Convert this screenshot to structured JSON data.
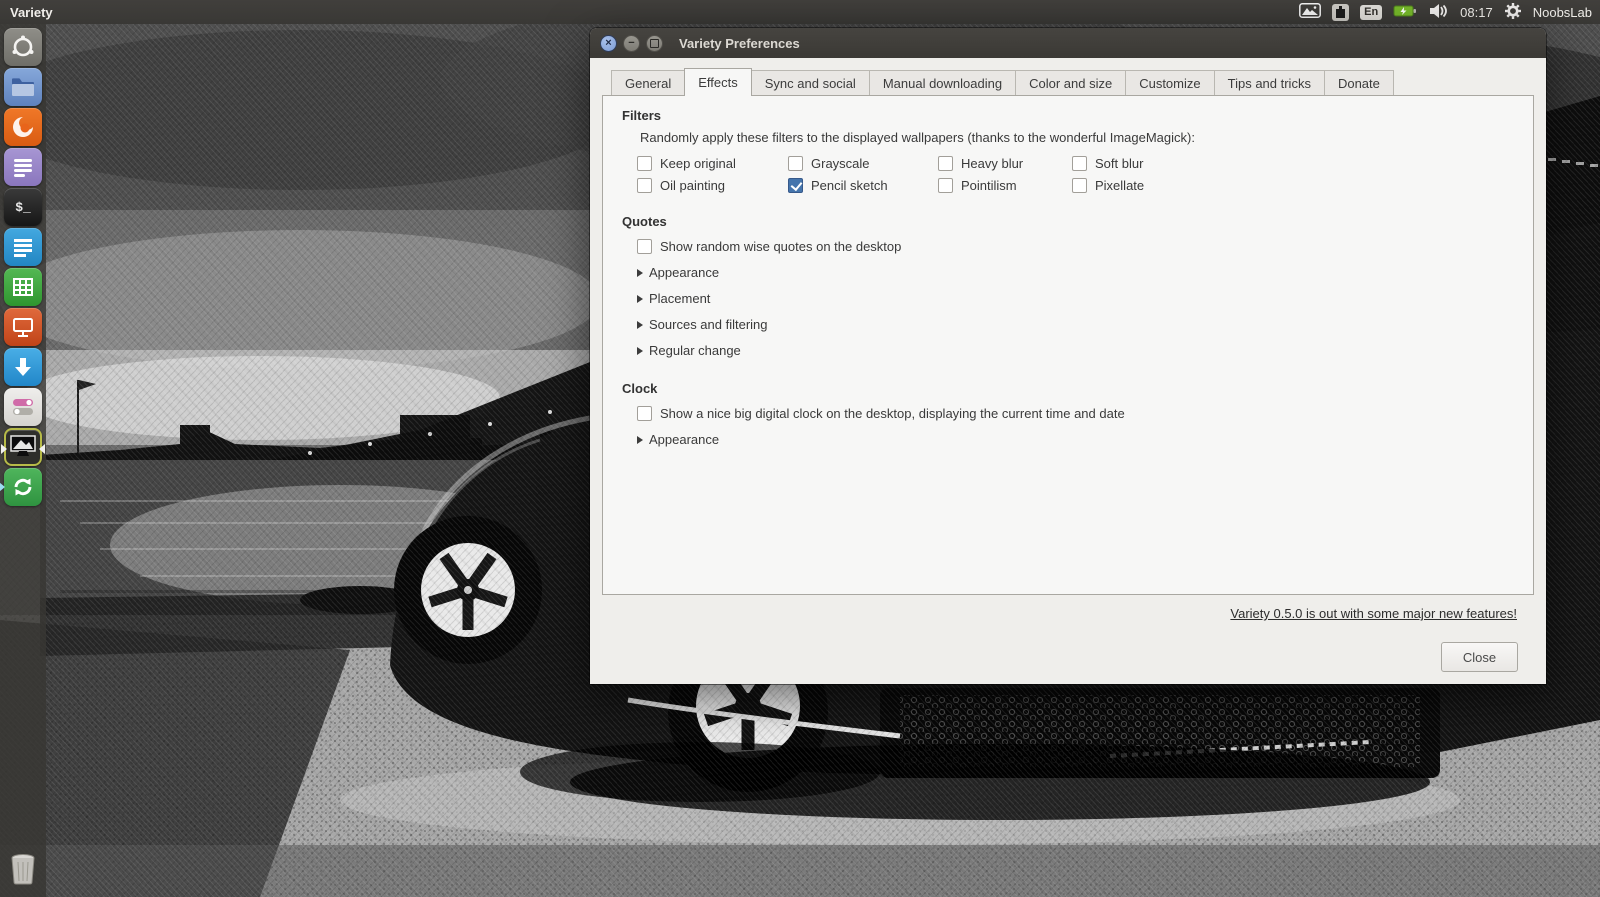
{
  "colors": {
    "accent_blue": "#4575ac",
    "titlebar": "#3c3b37",
    "dialog_bg": "#efeeeb",
    "page_bg": "#f7f7f6",
    "link": "#2c2c2c"
  },
  "panel": {
    "app_menu_label": "Variety",
    "keyboard_layout": "En",
    "clock": "08:17",
    "username": "NoobsLab",
    "tray_icons": [
      "variety-tray-icon",
      "network-icon",
      "keyboard-layout-badge",
      "battery-icon",
      "volume-icon",
      "gear-icon"
    ]
  },
  "launcher": {
    "icons": [
      "ubuntu-dash-icon",
      "files-icon",
      "firefox-icon",
      "notes-icon",
      "terminal-icon",
      "writer-icon",
      "calc-icon",
      "impress-icon",
      "download-icon",
      "settings-icon",
      "variety-icon",
      "sync-icon",
      "trash-icon"
    ]
  },
  "dialog": {
    "title": "Variety Preferences",
    "window_controls": [
      "close",
      "minimize",
      "maximize"
    ],
    "tabs": [
      {
        "label": "General",
        "active": false
      },
      {
        "label": "Effects",
        "active": true
      },
      {
        "label": "Sync and social",
        "active": false
      },
      {
        "label": "Manual downloading",
        "active": false
      },
      {
        "label": "Color and size",
        "active": false
      },
      {
        "label": "Customize",
        "active": false
      },
      {
        "label": "Tips and tricks",
        "active": false
      },
      {
        "label": "Donate",
        "active": false
      }
    ],
    "filters": {
      "heading": "Filters",
      "description": "Randomly apply these filters to the displayed wallpapers (thanks to the wonderful ImageMagick):",
      "options": [
        {
          "label": "Keep original",
          "checked": false
        },
        {
          "label": "Grayscale",
          "checked": false
        },
        {
          "label": "Heavy blur",
          "checked": false
        },
        {
          "label": "Soft blur",
          "checked": false
        },
        {
          "label": "Oil painting",
          "checked": false
        },
        {
          "label": "Pencil sketch",
          "checked": true
        },
        {
          "label": "Pointilism",
          "checked": false
        },
        {
          "label": "Pixellate",
          "checked": false
        }
      ]
    },
    "quotes": {
      "heading": "Quotes",
      "checkbox": {
        "label": "Show random wise quotes on the desktop",
        "checked": false
      },
      "expanders": [
        "Appearance",
        "Placement",
        "Sources and filtering",
        "Regular change"
      ]
    },
    "clock": {
      "heading": "Clock",
      "checkbox": {
        "label": "Show a nice big digital clock on the desktop, displaying the current time and date",
        "checked": false
      },
      "expanders": [
        "Appearance"
      ]
    },
    "footer": {
      "update_link": "Variety 0.5.0 is out with some major new features!",
      "close_label": "Close"
    }
  }
}
